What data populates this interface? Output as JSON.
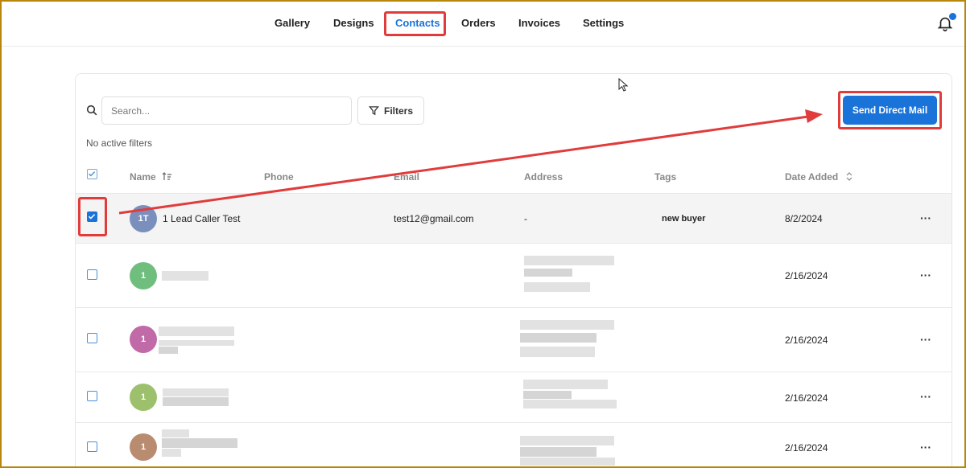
{
  "nav": {
    "items": [
      {
        "label": "Gallery"
      },
      {
        "label": "Designs"
      },
      {
        "label": "Contacts",
        "active": true
      },
      {
        "label": "Orders"
      },
      {
        "label": "Invoices"
      },
      {
        "label": "Settings"
      }
    ]
  },
  "toolbar": {
    "search_placeholder": "Search...",
    "filters_label": "Filters",
    "no_filters_text": "No active filters",
    "send_label": "Send Direct Mail"
  },
  "table": {
    "columns": {
      "name": "Name",
      "phone": "Phone",
      "email": "Email",
      "address": "Address",
      "tags": "Tags",
      "date_added": "Date Added"
    },
    "rows": [
      {
        "initials": "1T",
        "name": "1 Lead Caller Test",
        "email": "test12@gmail.com",
        "address": "-",
        "tag": "new buyer",
        "date": "8/2/2024",
        "checked": true,
        "avatar_color": "#7b8fbd",
        "more": "···"
      },
      {
        "initials": "1",
        "name": "",
        "email": "",
        "address": "",
        "tag": "",
        "date": "2/16/2024",
        "checked": false,
        "avatar_color": "#6fbe7e",
        "more": "···"
      },
      {
        "initials": "1",
        "name": "",
        "email": "",
        "address": "",
        "tag": "",
        "date": "2/16/2024",
        "checked": false,
        "avatar_color": "#c06aa8",
        "more": "···"
      },
      {
        "initials": "1",
        "name": "",
        "email": "",
        "address": "",
        "tag": "",
        "date": "2/16/2024",
        "checked": false,
        "avatar_color": "#9cc06c",
        "more": "···"
      },
      {
        "initials": "1",
        "name": "",
        "email": "",
        "address": "",
        "tag": "",
        "date": "2/16/2024",
        "checked": false,
        "avatar_color": "#b98c70",
        "more": "···"
      }
    ]
  },
  "colors": {
    "accent": "#1a73d9",
    "annotation": "#e03c3c"
  }
}
